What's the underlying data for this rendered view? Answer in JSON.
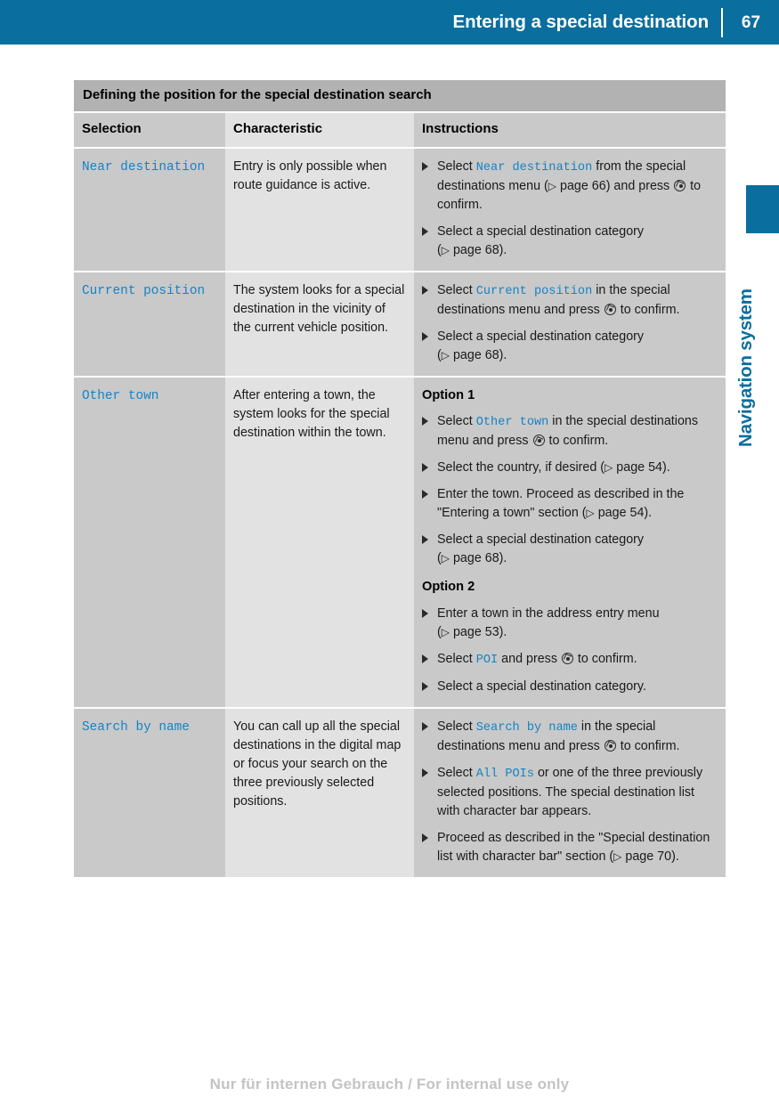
{
  "header": {
    "title": "Entering a special destination",
    "page_number": "67"
  },
  "side_tab": {
    "label": "Navigation system"
  },
  "table": {
    "caption": "Defining the position for the special destination search",
    "columns": [
      "Selection",
      "Characteristic",
      "Instructions"
    ],
    "rows": [
      {
        "selection": "Near destination",
        "characteristic": "Entry is only possible when route guidance is active.",
        "instructions": [
          {
            "parts": [
              {
                "t": "text",
                "v": "Select "
              },
              {
                "t": "mono",
                "v": "Near destination"
              },
              {
                "t": "text",
                "v": " from the special destinations menu ("
              },
              {
                "t": "pgref",
                "v": "page 66"
              },
              {
                "t": "text",
                "v": ") and press "
              },
              {
                "t": "knob",
                "v": ""
              },
              {
                "t": "text",
                "v": " to confirm."
              }
            ]
          },
          {
            "parts": [
              {
                "t": "text",
                "v": "Select a special destination category ("
              },
              {
                "t": "pgref",
                "v": "page 68"
              },
              {
                "t": "text",
                "v": ")."
              }
            ]
          }
        ]
      },
      {
        "selection": "Current position",
        "characteristic": "The system looks for a special destination in the vicinity of the current vehicle position.",
        "instructions": [
          {
            "parts": [
              {
                "t": "text",
                "v": "Select "
              },
              {
                "t": "mono",
                "v": "Current position"
              },
              {
                "t": "text",
                "v": " in the special destinations menu and press "
              },
              {
                "t": "knob",
                "v": ""
              },
              {
                "t": "text",
                "v": " to confirm."
              }
            ]
          },
          {
            "parts": [
              {
                "t": "text",
                "v": "Select a special destination category ("
              },
              {
                "t": "pgref",
                "v": "page 68"
              },
              {
                "t": "text",
                "v": ")."
              }
            ]
          }
        ]
      },
      {
        "selection": "Other town",
        "characteristic": "After entering a town, the system looks for the special destination within the town.",
        "option1_heading": "Option 1",
        "option2_heading": "Option 2",
        "instructions_option1": [
          {
            "parts": [
              {
                "t": "text",
                "v": "Select "
              },
              {
                "t": "mono",
                "v": "Other town"
              },
              {
                "t": "text",
                "v": " in the special destinations menu and press "
              },
              {
                "t": "knob",
                "v": ""
              },
              {
                "t": "text",
                "v": " to confirm."
              }
            ]
          },
          {
            "parts": [
              {
                "t": "text",
                "v": "Select the country, if desired ("
              },
              {
                "t": "pgref",
                "v": "page 54"
              },
              {
                "t": "text",
                "v": ")."
              }
            ]
          },
          {
            "parts": [
              {
                "t": "text",
                "v": "Enter the town. Proceed as described in the \"Entering a town\" section ("
              },
              {
                "t": "pgref",
                "v": "page 54"
              },
              {
                "t": "text",
                "v": ")."
              }
            ]
          },
          {
            "parts": [
              {
                "t": "text",
                "v": "Select a special destination category ("
              },
              {
                "t": "pgref",
                "v": "page 68"
              },
              {
                "t": "text",
                "v": ")."
              }
            ]
          }
        ],
        "instructions_option2": [
          {
            "parts": [
              {
                "t": "text",
                "v": "Enter a town in the address entry menu ("
              },
              {
                "t": "pgref",
                "v": "page 53"
              },
              {
                "t": "text",
                "v": ")."
              }
            ]
          },
          {
            "parts": [
              {
                "t": "text",
                "v": "Select "
              },
              {
                "t": "mono",
                "v": "POI"
              },
              {
                "t": "text",
                "v": " and press "
              },
              {
                "t": "knob",
                "v": ""
              },
              {
                "t": "text",
                "v": " to confirm."
              }
            ]
          },
          {
            "parts": [
              {
                "t": "text",
                "v": "Select a special destination category."
              }
            ]
          }
        ]
      },
      {
        "selection": "Search by name",
        "characteristic": "You can call up all the special destinations in the digital map or focus your search on the three previously selected positions.",
        "instructions": [
          {
            "parts": [
              {
                "t": "text",
                "v": "Select "
              },
              {
                "t": "mono",
                "v": "Search by name"
              },
              {
                "t": "text",
                "v": " in the special destinations menu and press "
              },
              {
                "t": "knob",
                "v": ""
              },
              {
                "t": "text",
                "v": " to confirm."
              }
            ]
          },
          {
            "parts": [
              {
                "t": "text",
                "v": "Select "
              },
              {
                "t": "mono",
                "v": "All POIs"
              },
              {
                "t": "text",
                "v": " or one of the three previously selected positions. The special destination list with character bar appears."
              }
            ]
          },
          {
            "parts": [
              {
                "t": "text",
                "v": "Proceed as described in the \"Special destination list with character bar\" section ("
              },
              {
                "t": "pgref",
                "v": "page 70"
              },
              {
                "t": "text",
                "v": ")."
              }
            ]
          }
        ]
      }
    ]
  },
  "footer": {
    "watermark": "Nur für internen Gebrauch / For internal use only"
  },
  "colors": {
    "header_blue": "#0A6E9E",
    "mono_blue": "#1583C4",
    "caption_gray": "#B2B2B2",
    "col_odd_gray": "#C9C9C9",
    "col_even_gray": "#E2E2E2"
  }
}
